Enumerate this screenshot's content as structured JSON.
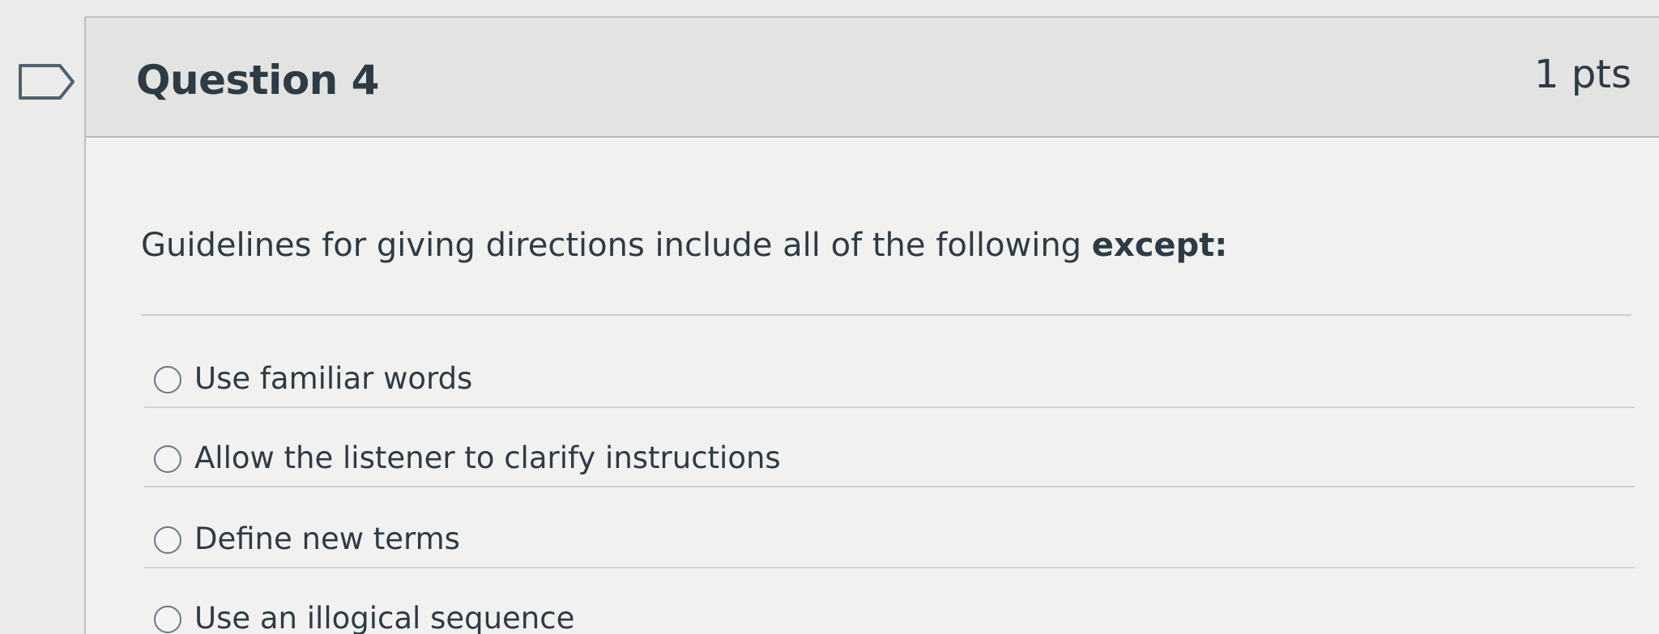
{
  "question": {
    "title": "Question 4",
    "points": "1 pts",
    "text_main": "Guidelines for giving directions include all of the following ",
    "text_emphasis": "except:",
    "answers": [
      {
        "label": "Use familiar words",
        "selected": false
      },
      {
        "label": "Allow the listener to clarify instructions",
        "selected": false
      },
      {
        "label": "Define new terms",
        "selected": false
      },
      {
        "label": "Use an illogical sequence",
        "selected": false
      }
    ]
  },
  "icons": {
    "flag": "flag-question-icon",
    "radio": "radio-unchecked-icon"
  },
  "colors": {
    "text": "#2d3b45",
    "header_bg": "#e3e3e1",
    "body_bg": "#f1f1ef"
  }
}
